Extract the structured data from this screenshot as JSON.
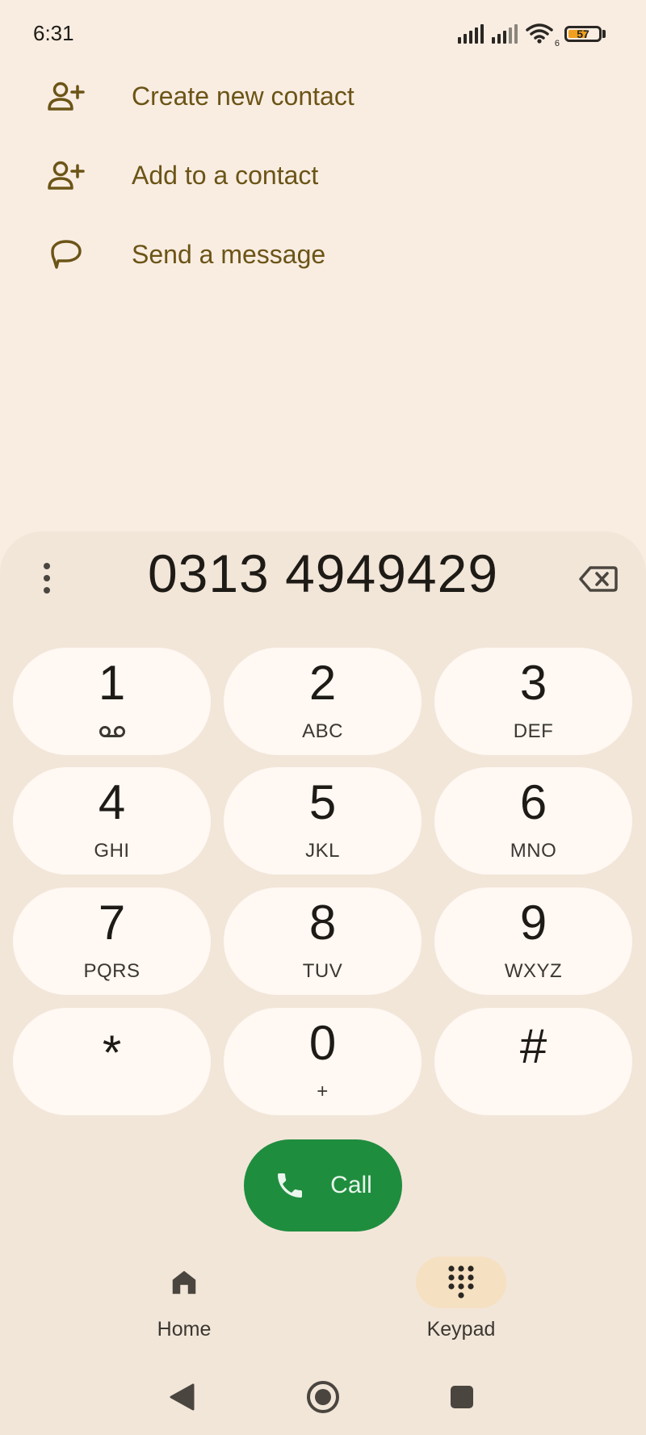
{
  "status_bar": {
    "time": "6:31",
    "battery_level": "57",
    "wifi_label": "6"
  },
  "actions": [
    {
      "label": "Create new contact",
      "icon": "add-person-icon"
    },
    {
      "label": "Add to a contact",
      "icon": "add-person-icon"
    },
    {
      "label": "Send a message",
      "icon": "message-icon"
    }
  ],
  "dialer": {
    "number": "0313 4949429",
    "keys": [
      {
        "digit": "1",
        "letters": ""
      },
      {
        "digit": "2",
        "letters": "ABC"
      },
      {
        "digit": "3",
        "letters": "DEF"
      },
      {
        "digit": "4",
        "letters": "GHI"
      },
      {
        "digit": "5",
        "letters": "JKL"
      },
      {
        "digit": "6",
        "letters": "MNO"
      },
      {
        "digit": "7",
        "letters": "PQRS"
      },
      {
        "digit": "8",
        "letters": "TUV"
      },
      {
        "digit": "9",
        "letters": "WXYZ"
      },
      {
        "digit": "*",
        "letters": ""
      },
      {
        "digit": "0",
        "letters": "+"
      },
      {
        "digit": "#",
        "letters": ""
      }
    ],
    "call_label": "Call"
  },
  "bottom_nav": {
    "home_label": "Home",
    "keypad_label": "Keypad",
    "active": "keypad"
  },
  "colors": {
    "background": "#f9ede2",
    "panel": "#f2e6d9",
    "key": "#fff8f3",
    "accent_text": "#6b5416",
    "call_green": "#1f8d3e",
    "nav_active": "#f6e0c2"
  }
}
